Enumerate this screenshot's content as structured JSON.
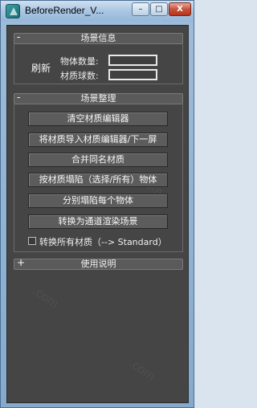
{
  "window": {
    "title": "BeforeRender_V...",
    "minimize": "–",
    "maximize": "□",
    "close": "X"
  },
  "panel_info": {
    "sign": "-",
    "title": "场景信息",
    "refresh": "刷新",
    "object_count_label": "物体数量:",
    "material_count_label": "材质球数:",
    "object_count_value": "",
    "material_count_value": ""
  },
  "panel_organize": {
    "sign": "-",
    "title": "场景整理",
    "buttons": [
      "清空材质编辑器",
      "将材质导入材质编辑器/下一屏",
      "合并同名材质",
      "按材质塌陷（选择/所有）物体",
      "分别塌陷每个物体",
      "转换为通道渲染场景"
    ],
    "checkbox_label": "转换所有材质（--> Standard）",
    "checkbox_checked": false
  },
  "panel_help": {
    "sign": "+",
    "title": "使用说明"
  }
}
